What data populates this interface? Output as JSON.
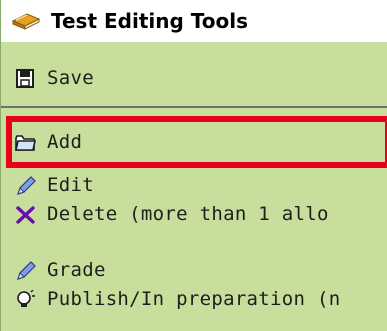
{
  "menu": {
    "title": "Test Editing Tools",
    "title_icon": "book-stack-icon",
    "items": [
      {
        "label": "Save",
        "icon": "save-floppy-icon"
      },
      {
        "label": "Add",
        "icon": "folder-icon"
      },
      {
        "label": "Edit",
        "icon": "pencil-icon"
      },
      {
        "label": "Delete (more than 1 allo",
        "icon": "x-delete-icon"
      },
      {
        "label": "Grade",
        "icon": "pencil-icon"
      },
      {
        "label": "Publish/In preparation (n",
        "icon": "lightbulb-icon"
      }
    ]
  },
  "colors": {
    "panel_bg": "#c8de9c",
    "header_bg": "#ffffff",
    "highlight": "#e8001c",
    "delete_x": "#6a0dad"
  }
}
